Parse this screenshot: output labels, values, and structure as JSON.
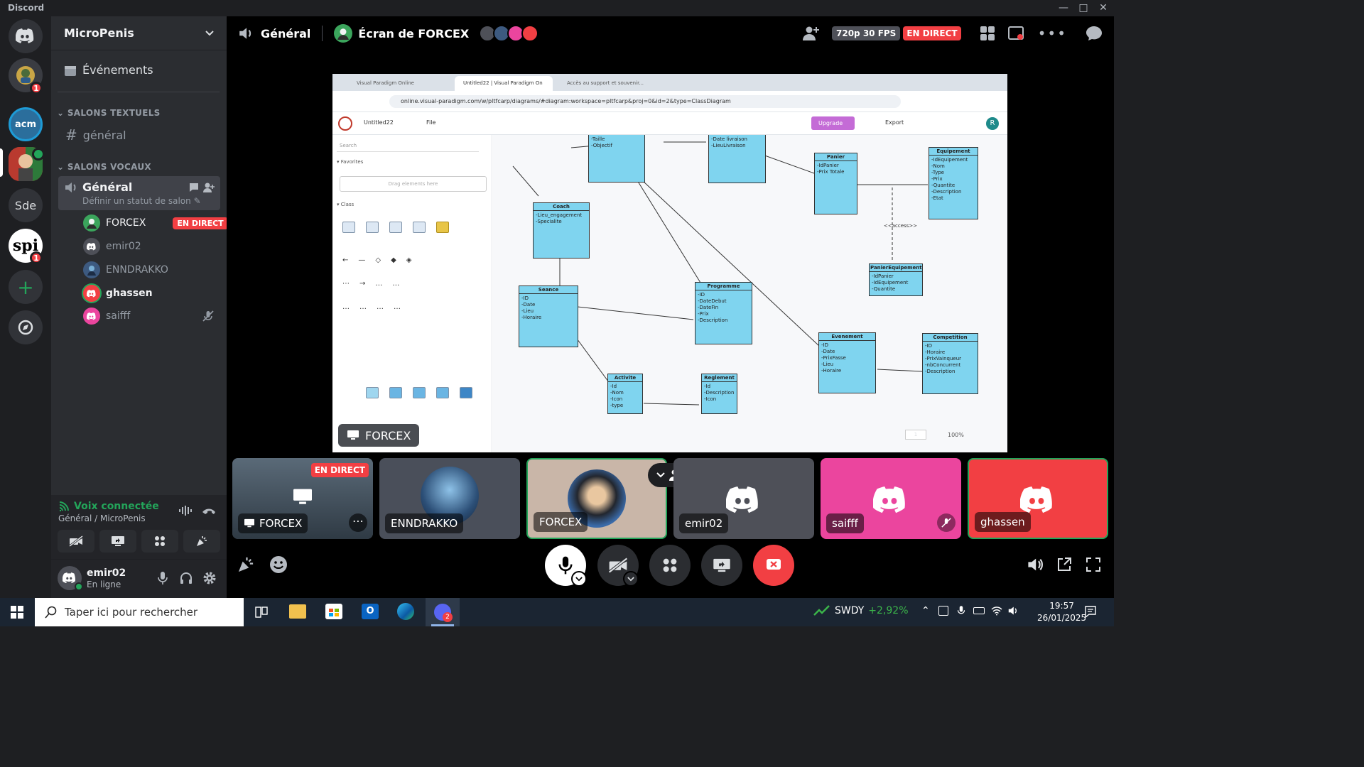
{
  "window": {
    "title": "Discord"
  },
  "servers": [
    {
      "name": "server-1",
      "badge": "1"
    },
    {
      "name": "acm",
      "label": "acm"
    },
    {
      "name": "active-server"
    },
    {
      "name": "Sde",
      "label": "Sde"
    },
    {
      "name": "spi",
      "label": "spi",
      "badge": "1"
    }
  ],
  "guild": {
    "name": "MicroPenis"
  },
  "sidebar": {
    "events_label": "Événements",
    "text_category": "SALONS TEXTUELS",
    "text_channel": "général",
    "voice_category": "SALONS VOCAUX",
    "voice_channel": "Général",
    "voice_status_prompt": "Définir un statut de salon",
    "voice_users": [
      {
        "name": "FORCEX",
        "live": "EN DIRECT",
        "color": "#3ba55c"
      },
      {
        "name": "emir02",
        "color": "#4e5058"
      },
      {
        "name": "ENNDRAKKO",
        "color": "#5865f2"
      },
      {
        "name": "ghassen",
        "color": "#f23f43"
      },
      {
        "name": "saifff",
        "color": "#eb459e"
      }
    ]
  },
  "voice_panel": {
    "status": "Voix connectée",
    "location": "Général / MicroPenis"
  },
  "user_panel": {
    "name": "emir02",
    "status": "En ligne"
  },
  "topbar": {
    "channel": "Général",
    "stream_title": "Écran de FORCEX",
    "quality": "720p 30 FPS",
    "live": "EN DIRECT"
  },
  "stream": {
    "owner_label": "FORCEX",
    "browser_tabs": [
      "Visual Paradigm Online",
      "Untitled22 | Visual Paradigm On",
      "Accès au support et souvenir..."
    ],
    "url": "online.visual-paradigm.com/w/pltfcarp/diagrams/#diagram:workspace=pltfcarp&proj=0&id=2&type=ClassDiagram",
    "doc_name": "Untitled22",
    "file_menu": "File",
    "upgrade": "Upgrade",
    "export": "Export",
    "search_placeholder": "Search",
    "favorites": "Favorites",
    "drag_hint": "Drag elements here",
    "class_section": "Class",
    "zoom": "100%",
    "page": "1",
    "access_label": "<<access>>",
    "classes": [
      {
        "name": "Coach",
        "attrs": "-Lieu_engagement\n-Specialite"
      },
      {
        "name": "Seance",
        "attrs": "-ID\n-Date\n-Lieu\n-Horaire"
      },
      {
        "name": "Programme",
        "attrs": "-ID\n-DateDebut\n-DateFin\n-Prix\n-Description"
      },
      {
        "name": "Activite",
        "attrs": "-Id\n-Nom\n-Icon\n-type"
      },
      {
        "name": "Reglement",
        "attrs": "-Id\n-Description\n-Icon"
      },
      {
        "name": "Panier",
        "attrs": "-IdPanier\n-Prix Totale"
      },
      {
        "name": "Equipement",
        "attrs": "-IdEquipement\n-Nom\n-Type\n-Prix\n-Quantite\n-Description\n-Etat"
      },
      {
        "name": "PanierEquipement",
        "attrs": "-IdPanier\n-IdEquipement\n-Quantite"
      },
      {
        "name": "Evenement",
        "attrs": "-ID\n-Date\n-PrixFasse\n-Lieu\n-Horaire"
      },
      {
        "name": "Competition",
        "attrs": "-ID\n-Horaire\n-PrixVainqueur\n-nbConcurrent\n-Description"
      }
    ],
    "top_class_1": "-Taille\n-Objectif",
    "top_class_2": "-Date livraison\n-LieuLivraison"
  },
  "tiles": [
    {
      "name": "FORCEX",
      "live": "EN DIRECT"
    },
    {
      "name": "ENNDRAKKO"
    },
    {
      "name": "FORCEX"
    },
    {
      "name": "emir02",
      "color": "#4e5058"
    },
    {
      "name": "saifff",
      "color": "#eb459e"
    },
    {
      "name": "ghassen",
      "color": "#f23f43"
    }
  ],
  "taskbar": {
    "search_placeholder": "Taper ici pour rechercher",
    "ticker": "SWDY",
    "ticker_change": "+2,92%",
    "time": "19:57",
    "date": "26/01/2025",
    "notif_count": "2"
  }
}
